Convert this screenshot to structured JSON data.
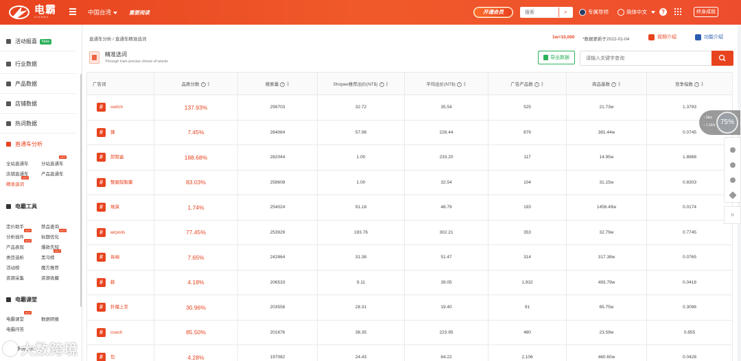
{
  "topbar": {
    "logo_text": "电霸",
    "logo_sub": "DIANBA",
    "region": "中国台湾",
    "slogan": "重要阅读",
    "vip_label": "开通会员",
    "search_placeholder": "搜索",
    "mentor_label": "专属导师",
    "language": "简体中文",
    "help": "?",
    "user_label": "终身成就"
  },
  "sidebar": {
    "items": [
      {
        "label": "活动报喜",
        "badge": "New"
      },
      {
        "label": "行业数据"
      },
      {
        "label": "产品数据"
      },
      {
        "label": "店铺数据"
      },
      {
        "label": "热词数据"
      },
      {
        "label": "直通车分析"
      }
    ],
    "ztc_sub": [
      "全站直通车",
      "分站直通车",
      "店铺直通车",
      "产品直通车",
      "精准选词"
    ],
    "tools_title": "电霸工具",
    "tools": [
      "定价助手",
      "禁品查询",
      "分析插件",
      "标题优化",
      "产品表现",
      "爆款先知",
      "类目选析",
      "黑马榜",
      "活动榜",
      "魔方推荐",
      "资源采集",
      "资源收藏"
    ],
    "class_title": "电霸课堂",
    "classes": [
      "电霸课堂",
      "数据研报",
      "电霸问答"
    ],
    "more": "多店模式",
    "hot": "HOT",
    "watermark": "大数跨境"
  },
  "main": {
    "breadcrumb": "直通车分析 / 直通车精准选词",
    "unit_note": "1w=10,000",
    "update_note": "*数据更新于2022-01-04",
    "video_link": "视频介绍",
    "feature_link": "功能介绍",
    "title": "精准选词",
    "subtitle": "Through train precise choice of words",
    "export_label": "导出数据",
    "keyword_placeholder": "请输入关键字查询"
  },
  "table": {
    "headers": [
      "广告词",
      "品质分数",
      "搜索量",
      "Shopee推荐出价(NT$)",
      "平均出价(NT$)",
      "广告产品数",
      "商品基数",
      "竞争指数"
    ],
    "rows": [
      [
        "switch",
        "137.93%",
        "299703",
        "32.72",
        "35.54",
        "525",
        "21.73w",
        "1.3793"
      ],
      [
        "鍊",
        "7.45%",
        "284084",
        "57.98",
        "228.44",
        "879",
        "381.44w",
        "0.0745"
      ],
      [
        "卸鉬盒",
        "188.68%",
        "282044",
        "1.00",
        "233.20",
        "117",
        "14.95w",
        "1.8868"
      ],
      [
        "整腿錯製藥",
        "83.03%",
        "258608",
        "1.00",
        "32.54",
        "104",
        "31.15w",
        "0.8303"
      ],
      [
        "現貨",
        "1.74%",
        "254024",
        "91.18",
        "48.79",
        "193",
        "1456.49w",
        "0.0174"
      ],
      [
        "airpods",
        "77.45%",
        "253929",
        "193.76",
        "302.21",
        "353",
        "32.79w",
        "0.7745"
      ],
      [
        "長袖",
        "7.65%",
        "242864",
        "31.38",
        "51.47",
        "314",
        "317.38w",
        "0.0765"
      ],
      [
        "鞋",
        "4.18%",
        "206533",
        "9.11",
        "39.05",
        "1,932",
        "493.79w",
        "0.0418"
      ],
      [
        "針織上衣",
        "30.96%",
        "203558",
        "28.31",
        "19.40",
        "91",
        "65.75w",
        "0.3096"
      ],
      [
        "coach",
        "85.50%",
        "201676",
        "38.35",
        "223.95",
        "480",
        "23.59w",
        "0.855"
      ],
      [
        "包",
        "4.28%",
        "197082",
        "24.43",
        "64.22",
        "2,106",
        "460.60w",
        "0.0428"
      ]
    ]
  },
  "float": {
    "progress": "75%",
    "speed_up": "0",
    "speed_down": "1.1",
    "speed_unit": "k/s",
    "expand": "»"
  },
  "colors": {
    "accent": "#e8431f",
    "green": "#2cb05a",
    "link_blue": "#2a5db0"
  },
  "icons": [
    "menu-icon",
    "search-icon",
    "globe-icon",
    "help-icon",
    "apps-grid-icon",
    "gift-icon",
    "chart-icon",
    "car-icon",
    "tool-icon",
    "class-icon",
    "video-icon",
    "info-icon",
    "excel-icon",
    "hash-icon",
    "question-icon",
    "sort-icon",
    "wechat-icon",
    "qq-icon",
    "phone-icon",
    "star-icon",
    "expand-icon"
  ]
}
